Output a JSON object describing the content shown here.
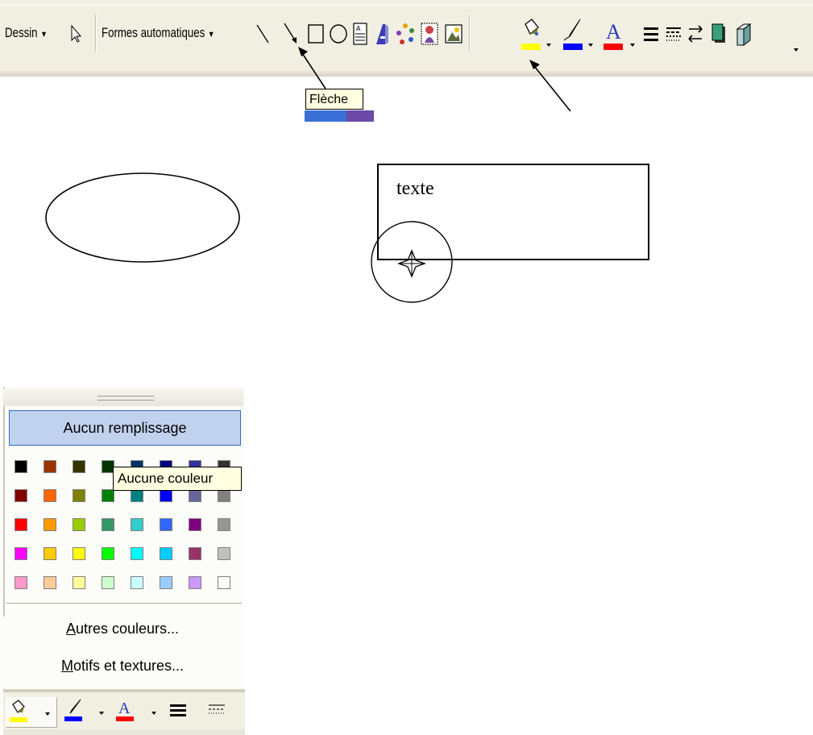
{
  "toolbar": {
    "draw_menu": "Dessin",
    "autoshapes_menu": "Formes automatiques",
    "tools": [
      {
        "icon": "select-objects-icon"
      },
      {
        "icon": "line-icon"
      },
      {
        "icon": "arrow-icon"
      },
      {
        "icon": "rectangle-icon"
      },
      {
        "icon": "oval-icon"
      },
      {
        "icon": "text-box-icon"
      },
      {
        "icon": "wordart-icon"
      },
      {
        "icon": "diagram-icon"
      },
      {
        "icon": "clip-art-icon"
      },
      {
        "icon": "picture-icon"
      },
      {
        "icon": "fill-color-icon"
      },
      {
        "icon": "line-color-icon"
      },
      {
        "icon": "font-color-icon"
      },
      {
        "icon": "line-style-icon"
      },
      {
        "icon": "dash-style-icon"
      },
      {
        "icon": "arrow-style-icon"
      },
      {
        "icon": "shadow-style-icon"
      },
      {
        "icon": "3d-style-icon"
      }
    ]
  },
  "arrow_tooltip": "Flèche",
  "textbox_text": "texte",
  "color_picker": {
    "no_fill": "Aucun remplissage",
    "tooltip": "Aucune couleur",
    "more_colors_prefix": "",
    "more_colors_underlined": "A",
    "more_colors_rest": "utres couleurs...",
    "patterns_prefix": "",
    "patterns_underlined": "M",
    "patterns_rest": "otifs et textures...",
    "palette": [
      [
        "#000000",
        "#993300",
        "#333300",
        "#003300",
        "#003366",
        "#000080",
        "#333399",
        "#333333"
      ],
      [
        "#800000",
        "#ff6600",
        "#808000",
        "#008000",
        "#008080",
        "#0000ff",
        "#666699",
        "#808080"
      ],
      [
        "#ff0000",
        "#ff9900",
        "#99cc00",
        "#339966",
        "#33cccc",
        "#3366ff",
        "#800080",
        "#969696"
      ],
      [
        "#ff00ff",
        "#ffcc00",
        "#ffff00",
        "#00ff00",
        "#00ffff",
        "#00ccff",
        "#993366",
        "#c0c0c0"
      ],
      [
        "#ff99cc",
        "#ffcc99",
        "#ffff99",
        "#ccffcc",
        "#ccffff",
        "#99ccff",
        "#cc99ff",
        "#ffffff"
      ]
    ]
  },
  "colors": {
    "fill_indicator": "#ffff00",
    "line_indicator": "#0000ff",
    "font_indicator": "#ff0000",
    "selection_blue": "#316ac5"
  }
}
